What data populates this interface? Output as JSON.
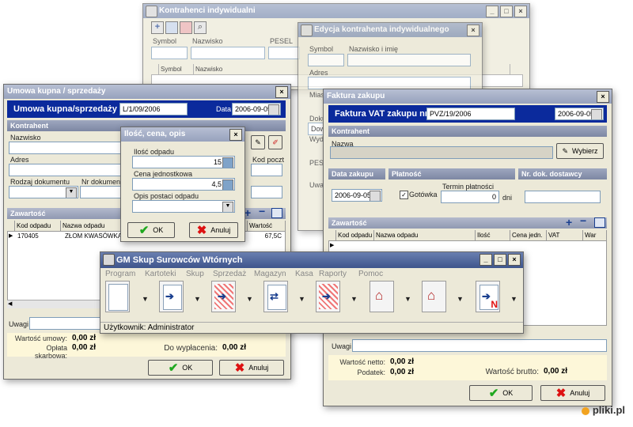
{
  "win_kontrahenci": {
    "title": "Kontrahenci indywidualni",
    "lbl_symbol": "Symbol",
    "lbl_nazwisko": "Nazwisko",
    "lbl_pesel": "PESEL",
    "col_symbol": "Symbol",
    "col_nazwisko": "Nazwisko"
  },
  "win_edycja": {
    "title": "Edycja kontrahenta indywidualnego",
    "lbl_symbol": "Symbol",
    "lbl_nazwisko_imie": "Nazwisko i imię",
    "lbl_adres": "Adres",
    "lbl_miasto": "Miasto",
    "lbl_dok": "Doku",
    "val_dok": "Dow",
    "lbl_wyd": "Wyd",
    "lbl_pesel": "PESE",
    "lbl_uwagi": "Uwa"
  },
  "win_umowa": {
    "title": "Umowa kupna / sprzedaży",
    "header": "Umowa kupna/sprzedaży nr",
    "number": "L/1/09/2006",
    "date_label": "Data",
    "date": "2006-09-05",
    "section_kontrahent": "Kontrahent",
    "lbl_nazwisko": "Nazwisko",
    "lbl_adres": "Adres",
    "lbl_rodzaj_dok": "Rodzaj dokumentu",
    "lbl_nr_dok": "Nr dokumentu",
    "lbl_kod_poczt": "Kod poczt",
    "section_zawartosc": "Zawartość",
    "col_kod": "Kod odpadu",
    "col_nazwa": "Nazwa odpadu",
    "col_wartosc": "Wartość",
    "row_kod": "170405",
    "row_nazwa": "ZŁOM KWASÓWKA",
    "row_wartosc": "67,5C",
    "lbl_uwagi": "Uwagi",
    "lbl_wartosc_umowy": "Wartość umowy:",
    "val_wartosc_umowy": "0,00 zł",
    "lbl_oplata": "Opłata skarbowa:",
    "val_oplata": "0,00 zł",
    "lbl_do_wyplacenia": "Do wypłacenia:",
    "val_do_wyplacenia": "0,00 zł",
    "ok": "OK",
    "anuluj": "Anuluj"
  },
  "win_ilosc": {
    "title": "Ilość, cena, opis",
    "lbl_ilosc": "Ilość odpadu",
    "val_ilosc": "15",
    "lbl_cena": "Cena jednostkowa",
    "val_cena": "4,5",
    "lbl_opis": "Opis postaci odpadu",
    "ok": "OK",
    "anuluj": "Anuluj"
  },
  "win_faktura": {
    "title": "Faktura zakupu",
    "header": "Faktura VAT zakupu nr",
    "number": "PVZ/19/2006",
    "date": "2006-09-05",
    "section_kontrahent": "Kontrahent",
    "lbl_nazwa": "Nazwa",
    "wybierz": "Wybierz",
    "section_data_zakupu": "Data zakupu",
    "data_zakupu": "2006-09-05",
    "section_platnosc": "Płatność",
    "gotowka": "Gotówka",
    "termin_label": "Termin płatności",
    "termin_val": "0",
    "dni": "dni",
    "section_nr_dok": "Nr. dok. dostawcy",
    "section_zawartosc": "Zawartość",
    "cols": [
      "Kod odpadu",
      "Nazwa odpadu",
      "Ilość",
      "Cena jedn.",
      "VAT",
      "War"
    ],
    "lbl_uwagi": "Uwagi",
    "lbl_netto": "Wartość netto:",
    "val_netto": "0,00 zł",
    "lbl_podatek": "Podatek:",
    "val_podatek": "0,00 zł",
    "lbl_brutto": "Wartość brutto:",
    "val_brutto": "0,00 zł",
    "ok": "OK",
    "anuluj": "Anuluj"
  },
  "win_main": {
    "title": "GM Skup Surowców Wtórnych",
    "menu": [
      "Program",
      "Kartoteki",
      "Skup",
      "Sprzedaż",
      "Magazyn",
      "Kasa",
      "Raporty",
      "Pomoc"
    ],
    "status": "Użytkownik: Administrator"
  },
  "watermark": "pliki.pl"
}
